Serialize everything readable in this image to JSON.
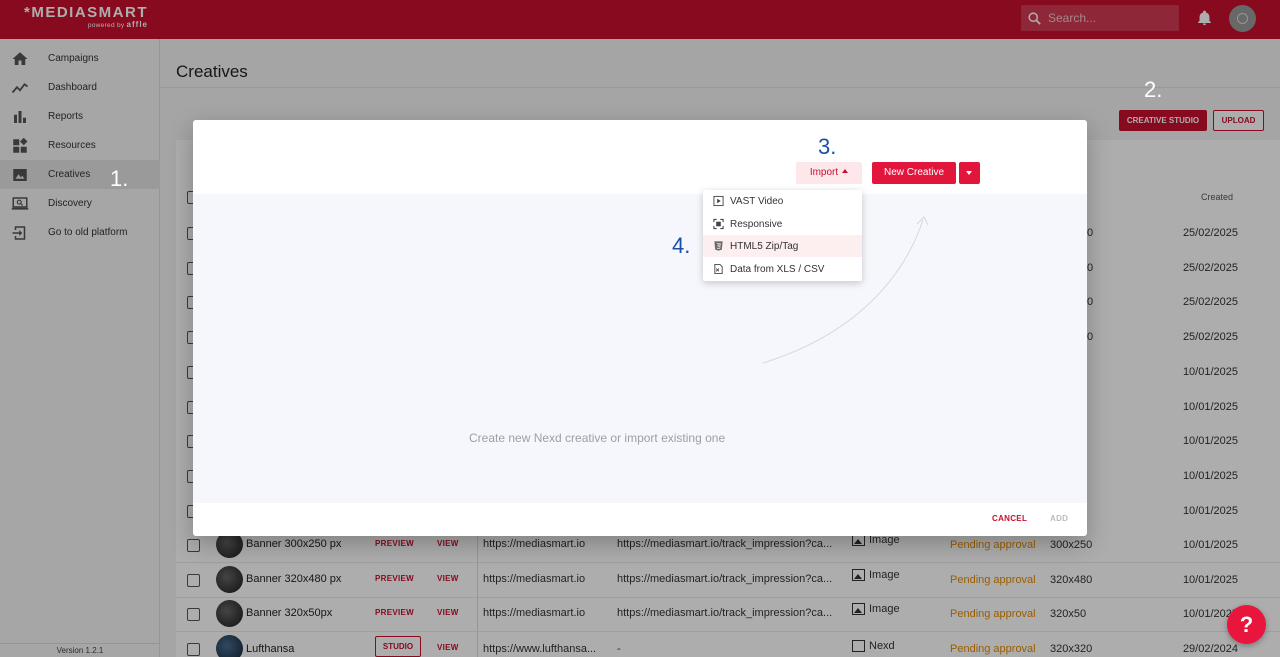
{
  "header": {
    "logo_main": "*MEDIASMART",
    "logo_sub": "powered by",
    "logo_brand": "affle",
    "search_placeholder": "Search..."
  },
  "sidebar": {
    "items": [
      {
        "label": "Campaigns",
        "icon": "home-icon"
      },
      {
        "label": "Dashboard",
        "icon": "trend-icon"
      },
      {
        "label": "Reports",
        "icon": "bar-chart-icon"
      },
      {
        "label": "Resources",
        "icon": "widgets-icon"
      },
      {
        "label": "Creatives",
        "icon": "image-icon",
        "active": true
      },
      {
        "label": "Discovery",
        "icon": "laptop-search-icon"
      },
      {
        "label": "Go to old platform",
        "icon": "exit-icon"
      }
    ],
    "version": "Version 1.2.1"
  },
  "page": {
    "title": "Creatives",
    "creative_studio_label": "CREATIVE STUDIO",
    "upload_label": "UPLOAD",
    "created_header": "Created"
  },
  "steps": {
    "s1": "1.",
    "s2": "2.",
    "s3": "3.",
    "s4": "4."
  },
  "background_rows": [
    {
      "frag": "0",
      "date": "25/02/2025"
    },
    {
      "frag": "0",
      "date": "25/02/2025"
    },
    {
      "frag": "0",
      "date": "25/02/2025"
    },
    {
      "frag": "0",
      "date": "25/02/2025"
    },
    {
      "frag": "",
      "date": "10/01/2025"
    },
    {
      "frag": "",
      "date": "10/01/2025"
    },
    {
      "frag": "",
      "date": "10/01/2025"
    },
    {
      "frag": "",
      "date": "10/01/2025"
    },
    {
      "frag": "",
      "date": "10/01/2025"
    }
  ],
  "table_rows": [
    {
      "name": "Banner 300x250 px",
      "preview": "PREVIEW",
      "view": "VIEW",
      "url1": "https://mediasmart.io",
      "url2": "https://mediasmart.io/track_impression?ca...",
      "type": "Image",
      "status": "Pending approval",
      "size": "300x250",
      "date": "10/01/2025"
    },
    {
      "name": "Banner 320x480 px",
      "preview": "PREVIEW",
      "view": "VIEW",
      "url1": "https://mediasmart.io",
      "url2": "https://mediasmart.io/track_impression?ca...",
      "type": "Image",
      "status": "Pending approval",
      "size": "320x480",
      "date": "10/01/2025"
    },
    {
      "name": "Banner 320x50px",
      "preview": "PREVIEW",
      "view": "VIEW",
      "url1": "https://mediasmart.io",
      "url2": "https://mediasmart.io/track_impression?ca...",
      "type": "Image",
      "status": "Pending approval",
      "size": "320x50",
      "date": "10/01/2025"
    },
    {
      "name": "Lufthansa",
      "preview": "STUDIO",
      "view": "VIEW",
      "url1": "https://www.lufthansa...",
      "url2": "-",
      "type": "Nexd",
      "status": "Pending approval",
      "size": "320x320",
      "date": "29/02/2024"
    }
  ],
  "modal": {
    "import_label": "Import",
    "new_creative_label": "New Creative",
    "empty_text": "Create new Nexd creative or import existing one",
    "cancel_label": "CANCEL",
    "add_label": "ADD",
    "menu": [
      {
        "label": "VAST Video",
        "icon": "video-file-icon"
      },
      {
        "label": "Responsive",
        "icon": "responsive-icon"
      },
      {
        "label": "HTML5 Zip/Tag",
        "icon": "html5-icon"
      },
      {
        "label": "Data from XLS / CSV",
        "icon": "spreadsheet-icon"
      }
    ]
  },
  "help_label": "?",
  "colors": {
    "brand": "#c8102e",
    "accent": "#e2163c",
    "pending": "#e58a00",
    "step_blue": "#1a4fa8"
  }
}
